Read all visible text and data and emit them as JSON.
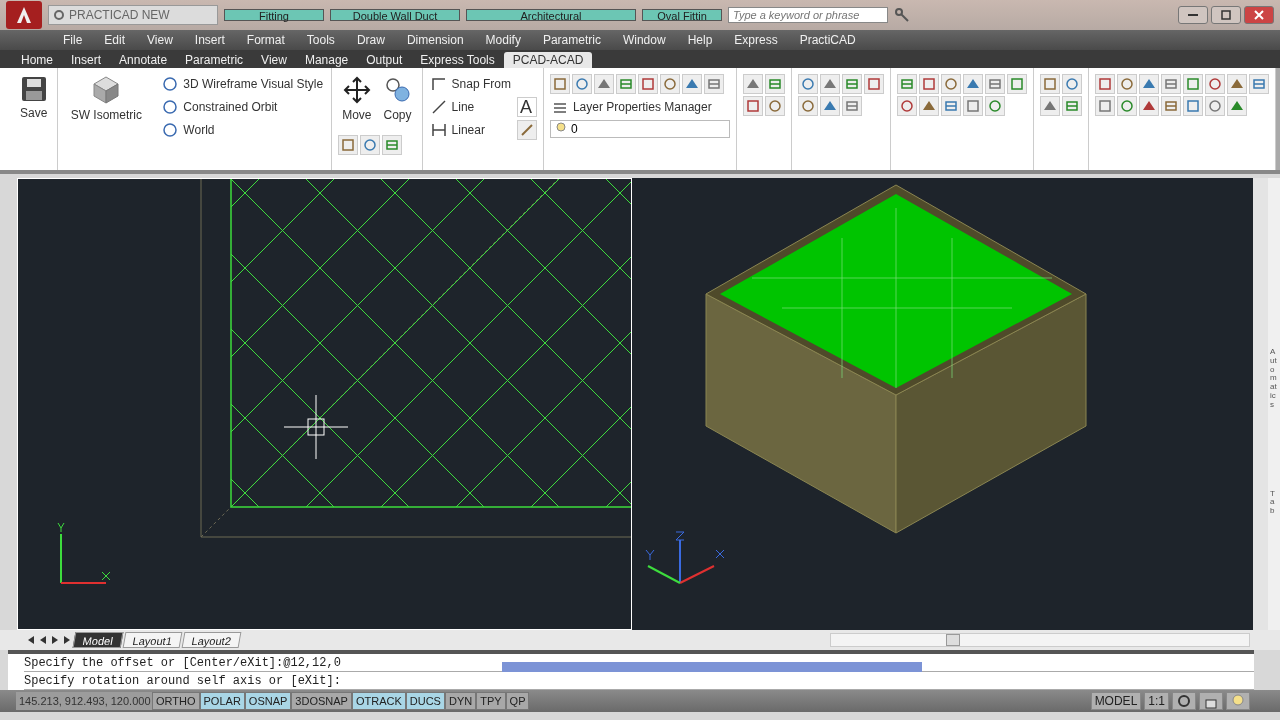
{
  "title_bar": {
    "workspace": "PRACTICAD NEW",
    "floating_toolbars": [
      {
        "label": "Fitting"
      },
      {
        "label": "Double Wall Duct"
      },
      {
        "label": "Architectural"
      },
      {
        "label": "Oval Fittin"
      }
    ],
    "search": {
      "placeholder": "Type a keyword or phrase"
    }
  },
  "menu_bar": [
    "File",
    "Edit",
    "View",
    "Insert",
    "Format",
    "Tools",
    "Draw",
    "Dimension",
    "Modify",
    "Parametric",
    "Window",
    "Help",
    "Express",
    "PractiCAD"
  ],
  "ribbon_tabs": [
    {
      "label": "Home",
      "selected": false
    },
    {
      "label": "Insert",
      "selected": false
    },
    {
      "label": "Annotate",
      "selected": false
    },
    {
      "label": "Parametric",
      "selected": false
    },
    {
      "label": "View",
      "selected": false
    },
    {
      "label": "Manage",
      "selected": false
    },
    {
      "label": "Output",
      "selected": false
    },
    {
      "label": "Express Tools",
      "selected": false
    },
    {
      "label": "PCAD-ACAD",
      "selected": true
    }
  ],
  "ribbon": {
    "save": "Save",
    "view": "SW Isometric",
    "view_rows": [
      "3D Wireframe Visual Style",
      "Constrained Orbit",
      "World"
    ],
    "move": "Move",
    "copy": "Copy",
    "draw_rows": [
      "Snap From",
      "Line",
      "Linear"
    ],
    "text_style": "A",
    "layer_manager": "Layer Properties Manager",
    "layer": "0"
  },
  "palette": {
    "tabs": [
      "Automatics",
      "Tab"
    ]
  },
  "layout_tabs": [
    {
      "label": "Model",
      "selected": true
    },
    {
      "label": "Layout1",
      "selected": false
    },
    {
      "label": "Layout2",
      "selected": false
    }
  ],
  "command_lines": [
    "Specify the offset or [Center/eXit]:@12,12,0",
    "Specify rotation around self axis or [eXit]:"
  ],
  "status_bar": {
    "coordinates": "145.213, 912.493, 120.000",
    "toggles": [
      {
        "label": "ORTHO",
        "on": false
      },
      {
        "label": "POLAR",
        "on": true
      },
      {
        "label": "OSNAP",
        "on": true
      },
      {
        "label": "3DOSNAP",
        "on": false
      },
      {
        "label": "OTRACK",
        "on": true
      },
      {
        "label": "DUCS",
        "on": true
      },
      {
        "label": "DYN",
        "on": false
      },
      {
        "label": "TPY",
        "on": false
      },
      {
        "label": "QP",
        "on": false
      }
    ],
    "space": "MODEL",
    "scale": "1:1"
  }
}
